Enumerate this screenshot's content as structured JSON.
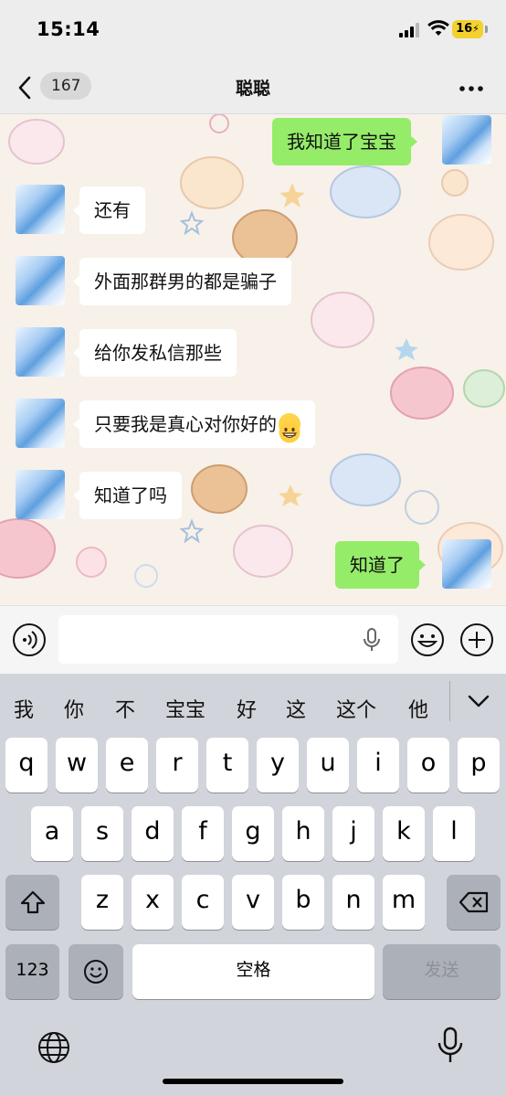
{
  "status_bar": {
    "time": "15:14",
    "battery": "16"
  },
  "nav": {
    "back_count": "167",
    "title": "聪聪",
    "more_icon": "more-icon"
  },
  "messages": [
    {
      "side": "right",
      "text": "我知道了宝宝"
    },
    {
      "side": "left",
      "text": "还有"
    },
    {
      "side": "left",
      "text": "外面那群男的都是骗子"
    },
    {
      "side": "left",
      "text": "给你发私信那些"
    },
    {
      "side": "left",
      "text": "只要我是真心对你好的",
      "emoji": "grinning-face"
    },
    {
      "side": "left",
      "text": "知道了吗"
    },
    {
      "side": "right",
      "text": "知道了"
    }
  ],
  "input_bar": {
    "voice_icon": "voice-icon",
    "emoji_icon": "emoji-icon",
    "plus_icon": "plus-icon",
    "field_value": ""
  },
  "keyboard": {
    "candidates": [
      "我",
      "你",
      "不",
      "宝宝",
      "好",
      "这",
      "这个",
      "他"
    ],
    "row1": [
      "q",
      "w",
      "e",
      "r",
      "t",
      "y",
      "u",
      "i",
      "o",
      "p"
    ],
    "row2": [
      "a",
      "s",
      "d",
      "f",
      "g",
      "h",
      "j",
      "k",
      "l"
    ],
    "row3": [
      "z",
      "x",
      "c",
      "v",
      "b",
      "n",
      "m"
    ],
    "numbers_label": "123",
    "space_label": "空格",
    "send_label": "发送"
  },
  "colors": {
    "bubble_sent": "#95ec69",
    "bubble_received": "#ffffff",
    "bar_bg": "#ededed",
    "keyboard_bg": "#d1d4da"
  }
}
